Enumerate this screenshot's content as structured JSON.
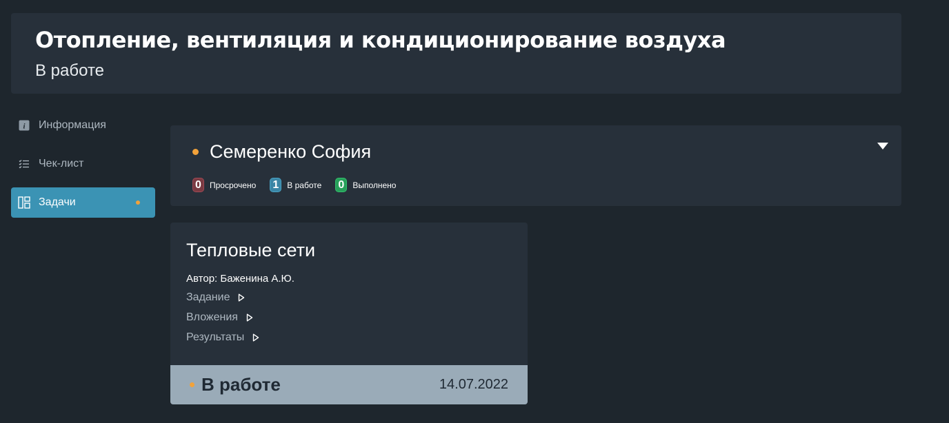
{
  "header": {
    "title": "Отопление, вентиляция и кондиционирование воздуха",
    "status": "В работе"
  },
  "sidebar": {
    "items": [
      {
        "label": "Информация",
        "icon": "info-icon"
      },
      {
        "label": "Чек-лист",
        "icon": "checklist-icon"
      },
      {
        "label": "Задачи",
        "icon": "board-icon",
        "active": true
      }
    ]
  },
  "person": {
    "name": "Семеренко София",
    "counters": [
      {
        "count": "0",
        "label": "Просрочено",
        "color": "#7a3a42"
      },
      {
        "count": "1",
        "label": "В работе",
        "color": "#3a86a6"
      },
      {
        "count": "0",
        "label": "Выполнено",
        "color": "#27a05a"
      }
    ]
  },
  "task": {
    "title": "Тепловые сети",
    "author": "Автор: Баженина А.Ю.",
    "links": [
      "Задание",
      "Вложения",
      "Результаты"
    ],
    "status": "В работе",
    "date": "14.07.2022"
  },
  "colors": {
    "accent": "#3b93b4",
    "status_dot": "#f2a23a",
    "background": "#1e262d",
    "panel": "#27303a"
  }
}
